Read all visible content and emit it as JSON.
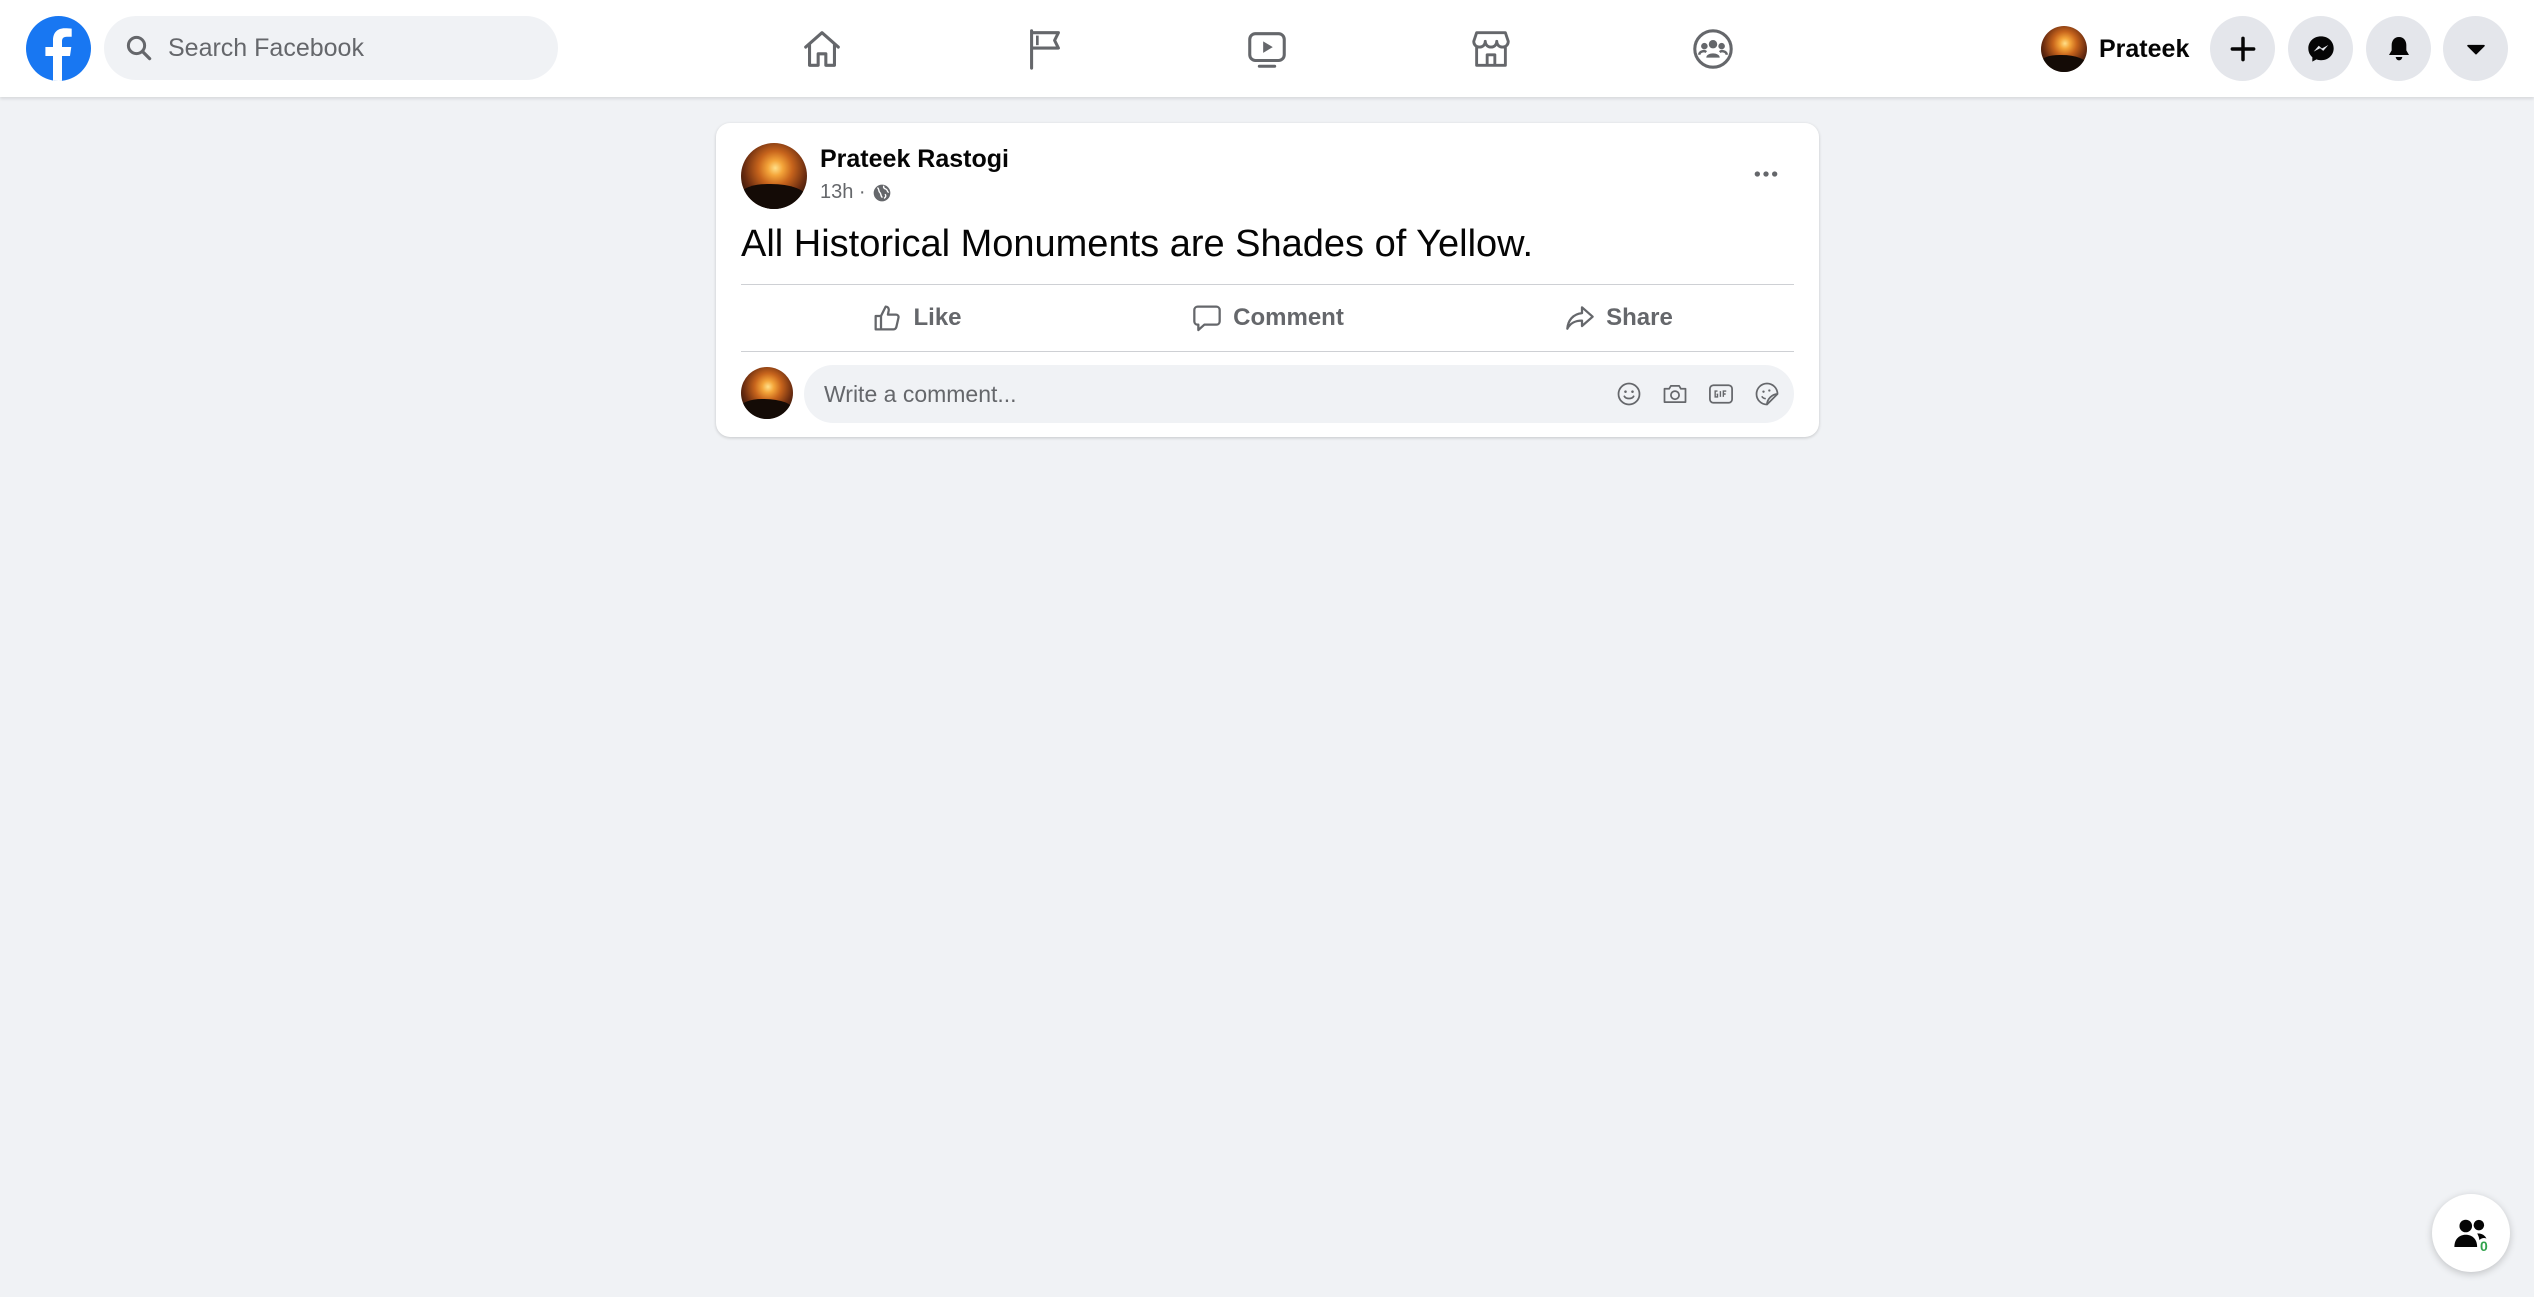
{
  "header": {
    "search": {
      "placeholder": "Search Facebook",
      "value": ""
    },
    "nav_icons": [
      "home-icon",
      "pages-flag-icon",
      "watch-video-icon",
      "marketplace-icon",
      "groups-icon"
    ],
    "profile_name": "Prateek",
    "action_icons": [
      "plus-icon",
      "messenger-icon",
      "notifications-bell-icon",
      "account-menu-caret-icon"
    ]
  },
  "post": {
    "author": "Prateek Rastogi",
    "time": "13h ·",
    "privacy_icon": "globe-icon",
    "text": "All Historical Monuments are Shades of Yellow.",
    "actions": {
      "like": "Like",
      "comment": "Comment",
      "share": "Share"
    },
    "comment_placeholder": "Write a comment...",
    "comment_icons": [
      "emoji-icon",
      "camera-icon",
      "gif-icon",
      "sticker-icon"
    ]
  },
  "contacts": {
    "count": "0"
  },
  "colors": {
    "brand": "#1877f2",
    "background": "#f0f2f5",
    "secondary_text": "#65676b",
    "online_green": "#31a24c"
  }
}
